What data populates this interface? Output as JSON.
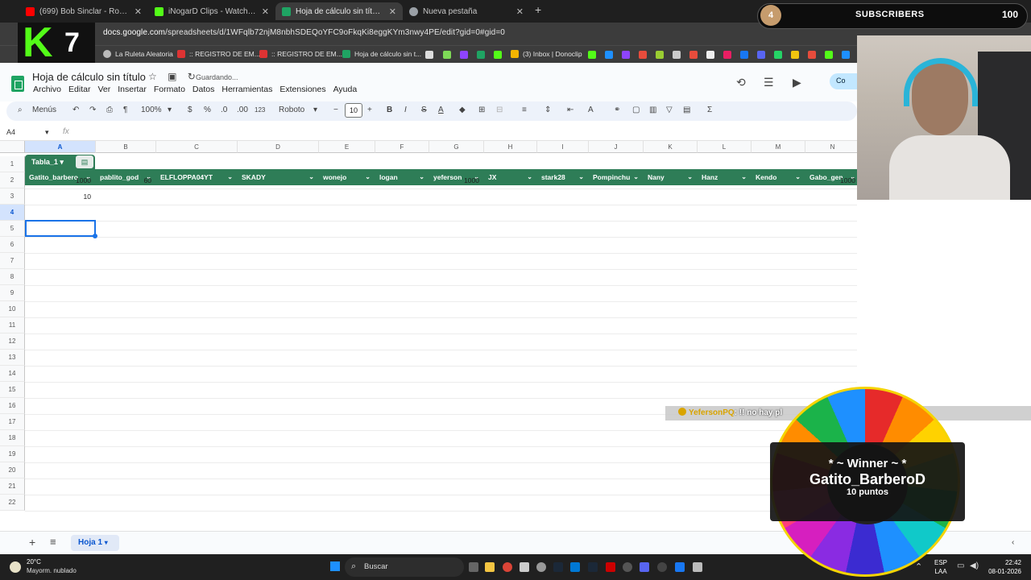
{
  "browser": {
    "tabs": [
      {
        "title": "(699) Bob Sinclar - Rock the Bo",
        "color": "#ff0000"
      },
      {
        "title": "iNogarD Clips - Watch Live on",
        "color": "#53fc18"
      },
      {
        "title": "Hoja de cálculo sin título - Hoja",
        "color": "#1fa463"
      },
      {
        "title": "Nueva pestaña",
        "color": "#9aa0a6"
      }
    ],
    "new_tab": "+",
    "url_host": "docs.google.com",
    "url_path": "/spreadsheets/d/1WFqlb72njM8nbhSDEQoYFC9oFkqKi8eggKYm3nwy4PE/edit?gid=0#gid=0",
    "bookmarks": [
      "La Ruleta Aleatoria",
      ":: REGISTRO DE EM...",
      ":: REGISTRO DE EM...",
      "Hoja de cálculo sin t...",
      "(3) Inbox | Donoclip"
    ]
  },
  "sheets": {
    "title": "Hoja de cálculo sin título",
    "status": "Guardando...",
    "menus": [
      "Archivo",
      "Editar",
      "Ver",
      "Insertar",
      "Formato",
      "Datos",
      "Herramientas",
      "Extensiones",
      "Ayuda"
    ],
    "share_label": "Co",
    "toolbar": {
      "menus": "Menús",
      "zoom": "100%",
      "currency": "$",
      "percent": "%",
      "dec_less": ".0",
      "dec_more": ".00",
      "format_num": "123",
      "font": "Roboto",
      "font_size": "10",
      "minus": "−",
      "plus": "+"
    },
    "name_box": "A4",
    "fx": "fx",
    "columns": [
      {
        "letter": "A"
      },
      {
        "letter": "B"
      },
      {
        "letter": "C"
      },
      {
        "letter": "D"
      },
      {
        "letter": "E"
      },
      {
        "letter": "F"
      },
      {
        "letter": "G"
      },
      {
        "letter": "H"
      },
      {
        "letter": "I"
      },
      {
        "letter": "J"
      },
      {
        "letter": "K"
      },
      {
        "letter": "L"
      },
      {
        "letter": "M"
      },
      {
        "letter": "N"
      }
    ],
    "table_name": "Tabla_1",
    "headers": [
      "Gatito_barbero",
      "pablito_god",
      "ELFLOPPA04YT",
      "SKADY",
      "wonejo",
      "logan",
      "yeferson",
      "JX",
      "stark28",
      "Pompinchu",
      "Nany",
      "Hanz",
      "Kendo",
      "Gabo_gen"
    ],
    "rows": [
      {
        "row": 2,
        "cells": [
          {
            "col": 0,
            "value": "1000"
          },
          {
            "col": 1,
            "value": "60"
          },
          {
            "col": 6,
            "value": "1000"
          },
          {
            "col": 13,
            "value": "1000"
          }
        ]
      },
      {
        "row": 3,
        "cells": [
          {
            "col": 0,
            "value": "10"
          }
        ]
      }
    ],
    "row_numbers": [
      "1",
      "2",
      "3",
      "4",
      "5",
      "6",
      "7",
      "8",
      "9",
      "10",
      "11",
      "12",
      "13",
      "14",
      "15",
      "16",
      "17",
      "18",
      "19",
      "20",
      "21",
      "22"
    ],
    "selected_row": "4",
    "sheet_tab": "Hoja 1",
    "add_sheet": "+",
    "all_sheets": "≡"
  },
  "taskbar": {
    "weather_temp": "20°C",
    "weather_desc": "Mayorm. nublado",
    "search_label": "Buscar",
    "lang_top": "ESP",
    "lang_bottom": "LAA",
    "time": "22:42",
    "date": "08-01-2026"
  },
  "overlay": {
    "channel_number": "7",
    "subs_level": "4",
    "subs_label": "SUBSCRIBERS",
    "subs_count": "100",
    "chat_user": "YefersonPQ",
    "chat_msg": ": !! no hay pl",
    "winner_title": "* ~ Winner ~ *",
    "winner_name": "Gatito_BarberoD",
    "winner_points": "10 puntos"
  },
  "colors": {
    "table_header": "#2e7d57",
    "selection": "#1a73e8",
    "kick_green": "#53fc18"
  }
}
